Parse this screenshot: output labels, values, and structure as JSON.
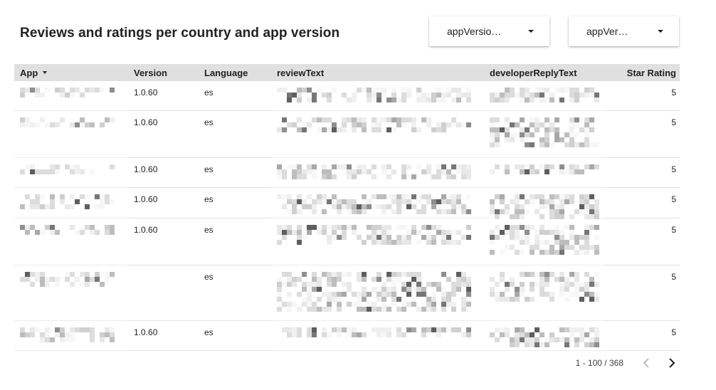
{
  "report": {
    "title": "Reviews and ratings per country and app version"
  },
  "filters": {
    "filter1_label": "appVersio…",
    "filter2_label": "appVer…"
  },
  "table": {
    "columns": [
      "App",
      "Version",
      "Language",
      "reviewText",
      "developerReplyText",
      "Star Rating"
    ],
    "rows": [
      {
        "app": "",
        "version": "1.0.60",
        "language": "es",
        "review": "",
        "reply": "",
        "stars": "5"
      },
      {
        "app": "",
        "version": "1.0.60",
        "language": "es",
        "review": "",
        "reply": "",
        "stars": "5"
      },
      {
        "app": "",
        "version": "1.0.60",
        "language": "es",
        "review": "",
        "reply": "",
        "stars": "5"
      },
      {
        "app": "",
        "version": "1.0.60",
        "language": "es",
        "review": "",
        "reply": "",
        "stars": "5"
      },
      {
        "app": "",
        "version": "1.0.60",
        "language": "es",
        "review": "",
        "reply": "",
        "stars": "5"
      },
      {
        "app": "",
        "version": "",
        "language": "es",
        "review": "",
        "reply": "",
        "stars": "5"
      },
      {
        "app": "",
        "version": "1.0.60",
        "language": "es",
        "review": "",
        "reply": "",
        "stars": "5"
      }
    ]
  },
  "pagination": {
    "range": "1 - 100 / 368",
    "prev_icon": "chevron-left-icon",
    "next_icon": "chevron-right-icon"
  }
}
